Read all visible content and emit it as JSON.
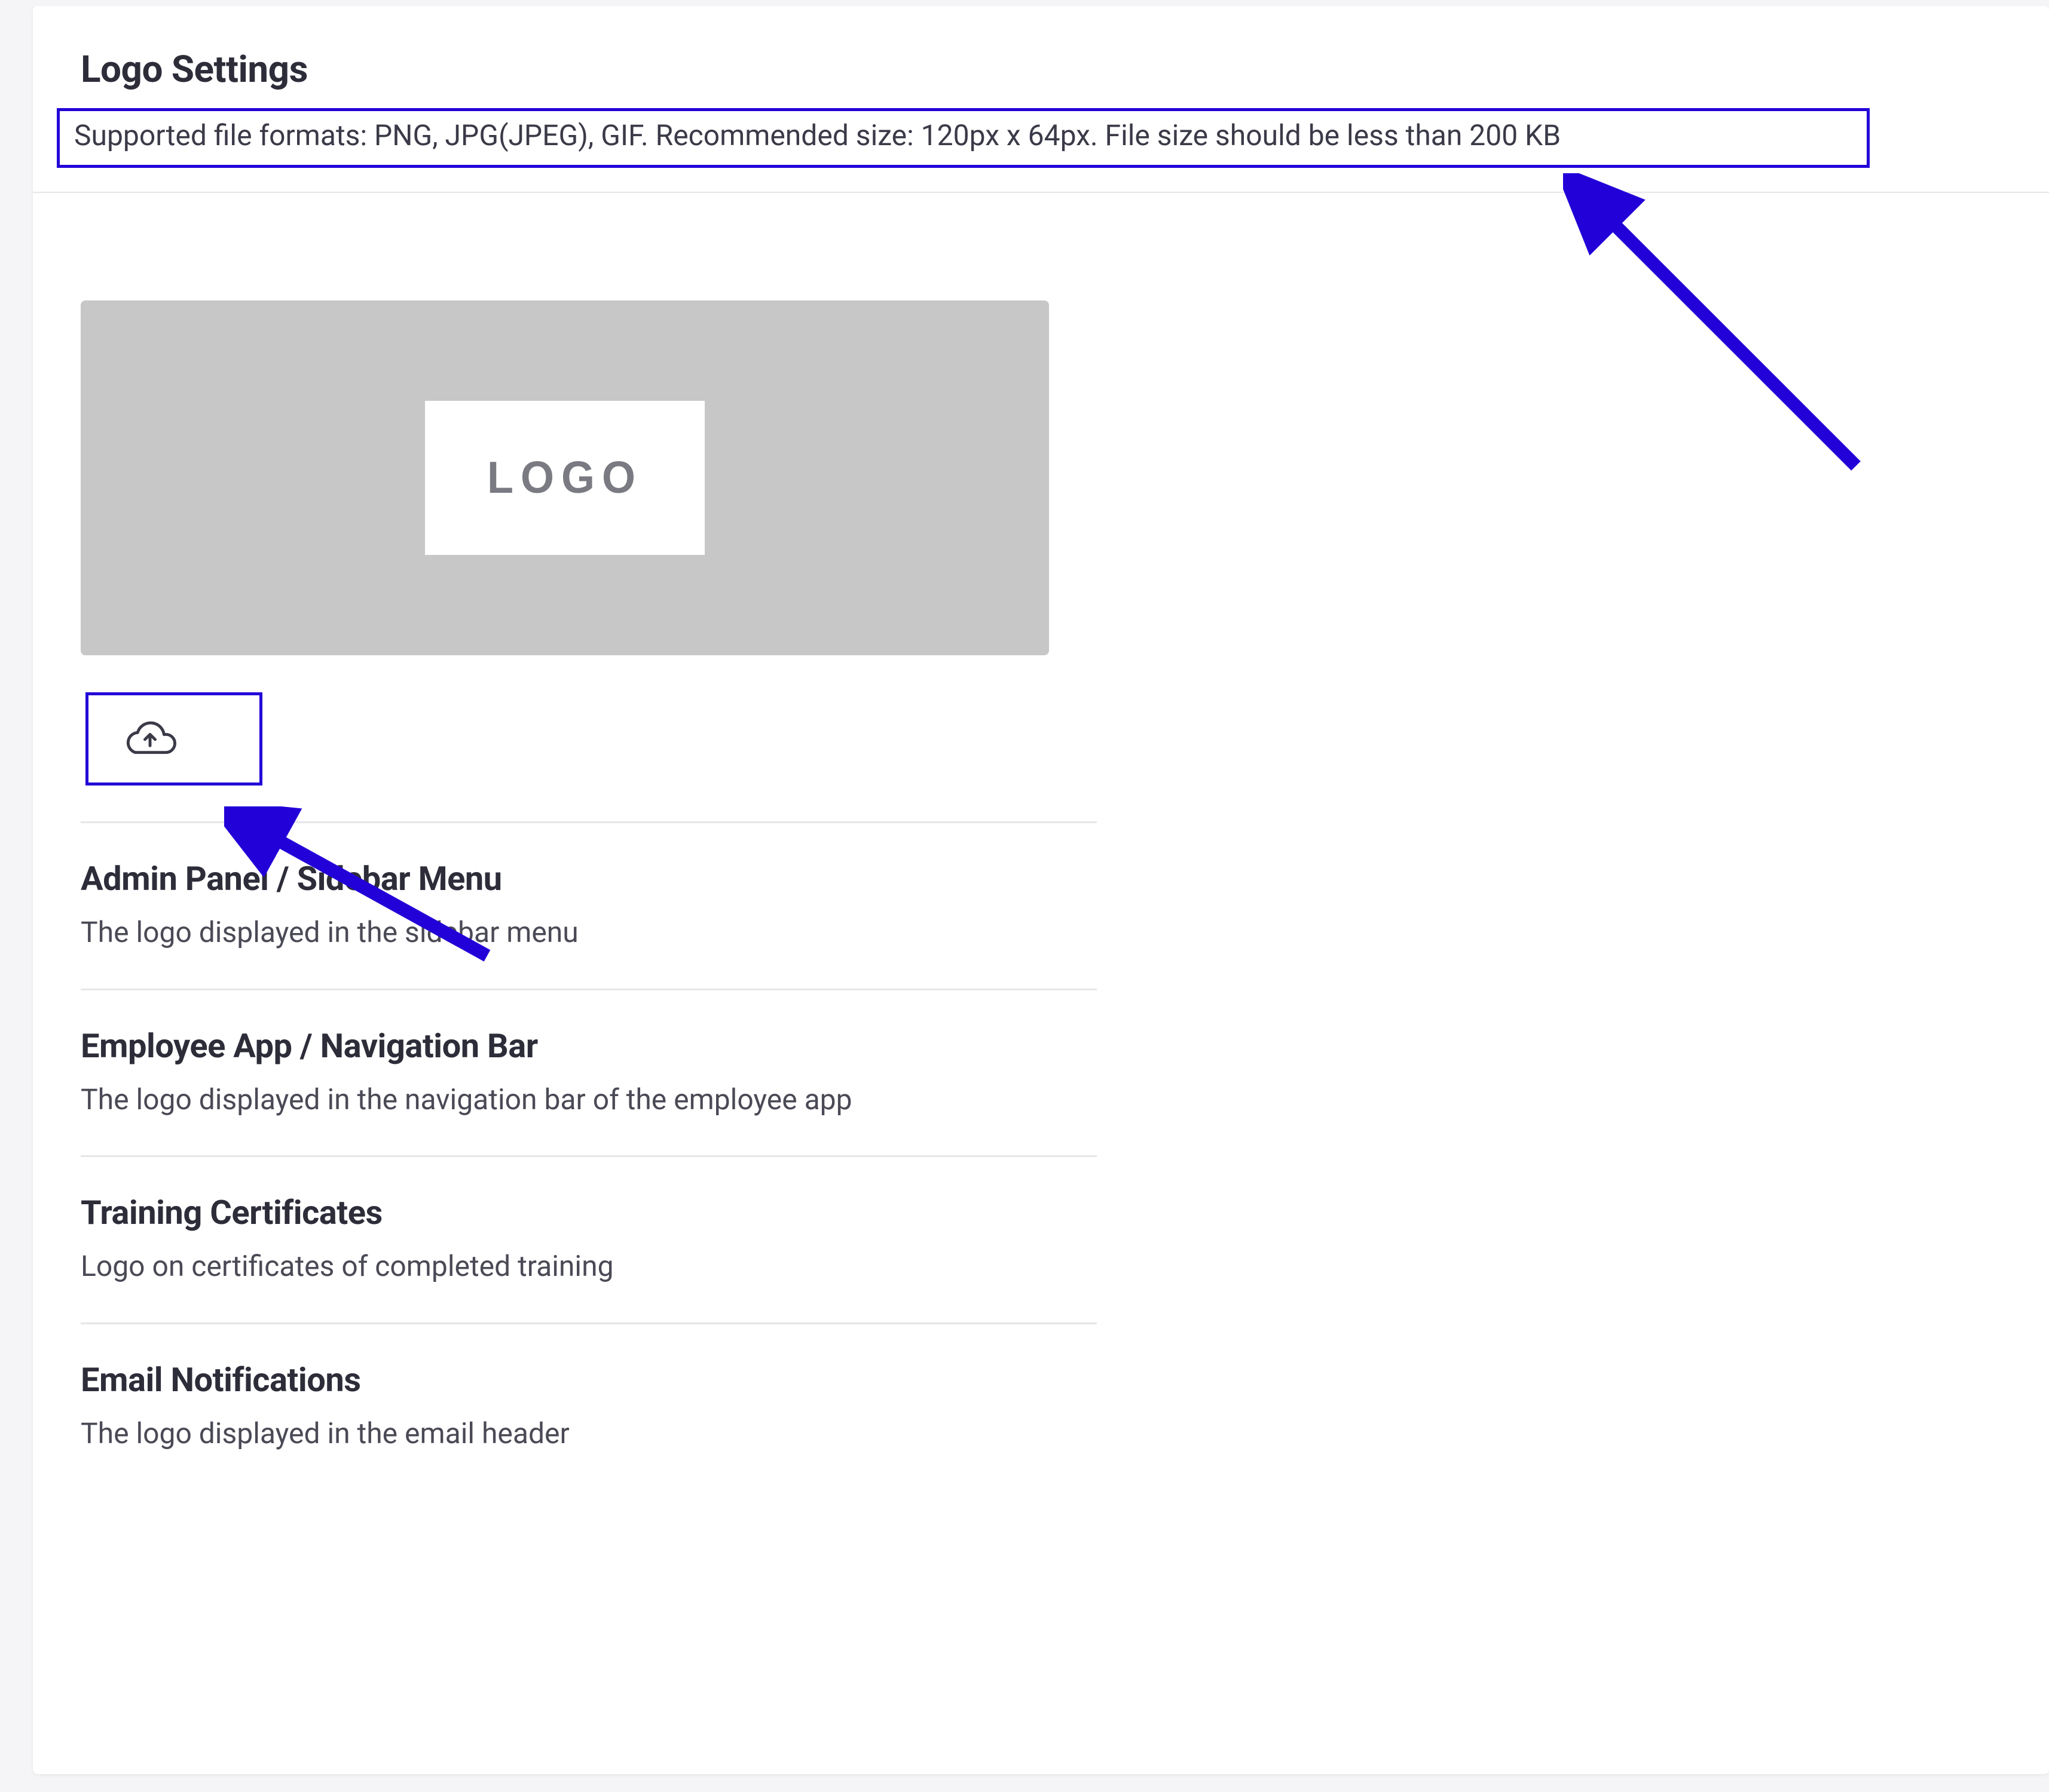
{
  "page": {
    "title": "Logo Settings",
    "info_text": "Supported file formats: PNG, JPG(JPEG), GIF. Recommended size: 120px x 64px. File size should be less than 200 KB"
  },
  "preview": {
    "placeholder_text": "LOGO"
  },
  "upload": {
    "icon_name": "cloud-upload"
  },
  "sections": [
    {
      "title": "Admin Panel / Sidebar Menu",
      "description": "The logo displayed in the sidebar menu"
    },
    {
      "title": "Employee App / Navigation Bar",
      "description": "The logo displayed in the navigation bar of the employee app"
    },
    {
      "title": "Training Certificates",
      "description": "Logo on certificates of completed training"
    },
    {
      "title": "Email Notifications",
      "description": "The logo displayed in the email header"
    }
  ],
  "annotations": {
    "highlight_color": "#2200d8"
  }
}
